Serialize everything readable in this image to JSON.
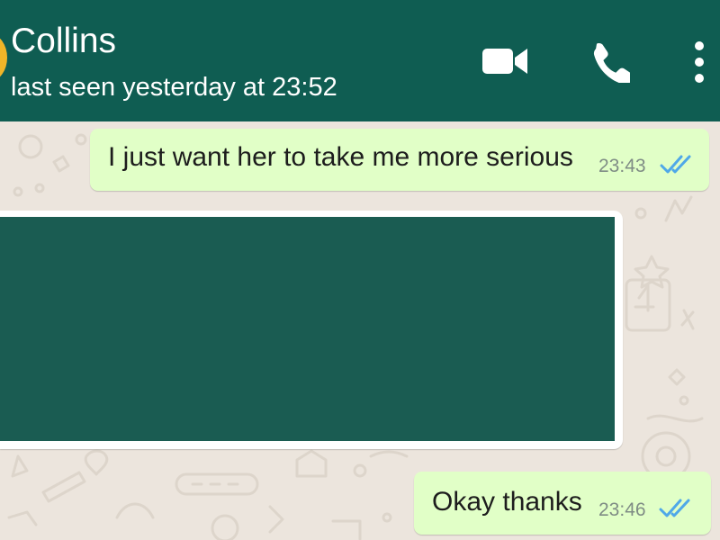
{
  "header": {
    "contact_name": "Collins",
    "status": "last seen yesterday at 23:52",
    "background_color": "#0f5d52",
    "icons": [
      "avatar",
      "video-call-icon",
      "phone-call-icon",
      "more-options-icon"
    ]
  },
  "messages": [
    {
      "direction": "sent",
      "text": "I just want her to take me more serious",
      "time": "23:43",
      "status_icon": "double-check-read-icon"
    },
    {
      "direction": "received",
      "media": "hidden-media",
      "media_color": "#1a5c52"
    },
    {
      "direction": "sent",
      "text": "Okay thanks",
      "time": "23:46",
      "status_icon": "double-check-read-icon"
    }
  ],
  "colors": {
    "sent_bubble": "#e1ffc7",
    "chat_background": "#ece5dd",
    "read_ticks": "#4fa8e8"
  }
}
